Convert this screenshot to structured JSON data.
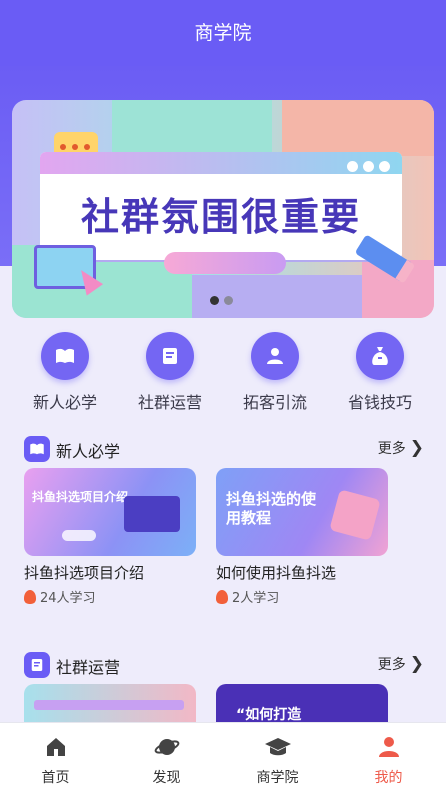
{
  "header": {
    "title": "商学院"
  },
  "banner": {
    "headline": "社群氛围很重要",
    "slide_count": 2,
    "active_slide": 1
  },
  "quick_links": [
    {
      "label": "新人必学",
      "icon": "book-icon"
    },
    {
      "label": "社群运营",
      "icon": "document-icon"
    },
    {
      "label": "拓客引流",
      "icon": "person-icon"
    },
    {
      "label": "省钱技巧",
      "icon": "money-bag-icon"
    }
  ],
  "sections": [
    {
      "title": "新人必学",
      "more_label": "更多",
      "courses": [
        {
          "title": "抖鱼抖选项目介绍",
          "learners": "24人学习",
          "thumb_text": "抖鱼抖选项目介绍"
        },
        {
          "title": "如何使用抖鱼抖选",
          "learners": "2人学习",
          "thumb_text": "抖鱼抖选的使用教程"
        }
      ]
    },
    {
      "title": "社群运营",
      "more_label": "更多",
      "courses": [
        {
          "thumb_text": ""
        },
        {
          "thumb_text": "“如何打造"
        }
      ]
    }
  ],
  "tabbar": [
    {
      "label": "首页",
      "icon": "home-icon",
      "active": false
    },
    {
      "label": "发现",
      "icon": "planet-icon",
      "active": false
    },
    {
      "label": "商学院",
      "icon": "graduation-cap-icon",
      "active": false
    },
    {
      "label": "我的",
      "icon": "user-icon",
      "active": true
    }
  ],
  "colors": {
    "primary": "#6a5cf5",
    "active_tab": "#ee5a4a",
    "background": "#eeecfb"
  }
}
